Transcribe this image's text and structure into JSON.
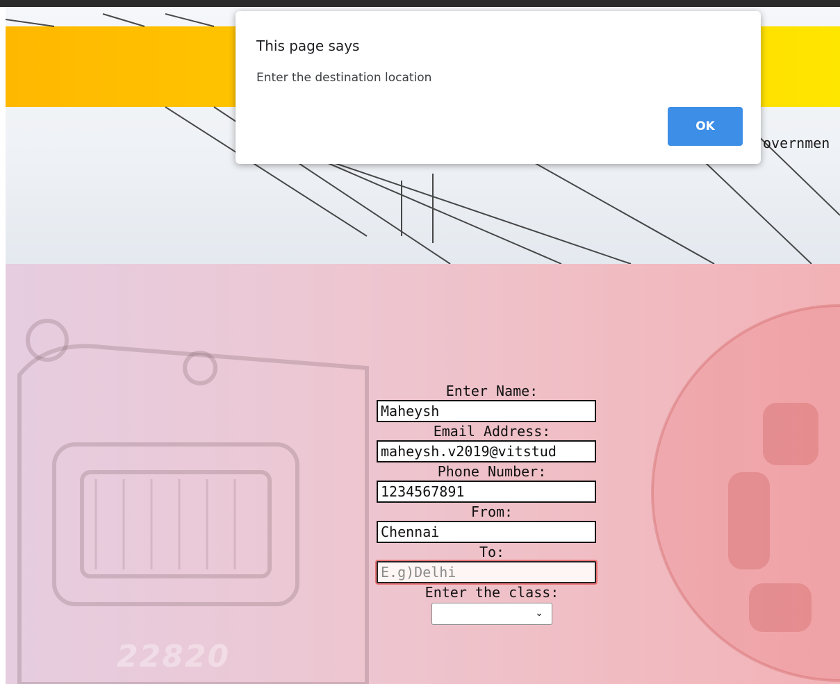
{
  "header": {
    "partial_text": "overnmen"
  },
  "dialog": {
    "title": "This page says",
    "message": "Enter the destination location",
    "ok_label": "OK"
  },
  "form": {
    "name_label": "Enter Name:",
    "name_value": "Maheysh",
    "email_label": "Email Address:",
    "email_value": "maheysh.v2019@vitstud",
    "phone_label": "Phone Number:",
    "phone_value": "1234567891",
    "from_label": "From:",
    "from_value": "Chennai",
    "to_label": "To:",
    "to_placeholder": "E.g)Delhi",
    "class_label": "Enter the class:"
  },
  "background": {
    "train_number": "22820"
  },
  "colors": {
    "accent_button": "#3d8ee6",
    "header_bar": "#ffcc00",
    "focus_ring": "#e65050"
  },
  "icons": {
    "select_arrow": "chevron-down-icon"
  }
}
